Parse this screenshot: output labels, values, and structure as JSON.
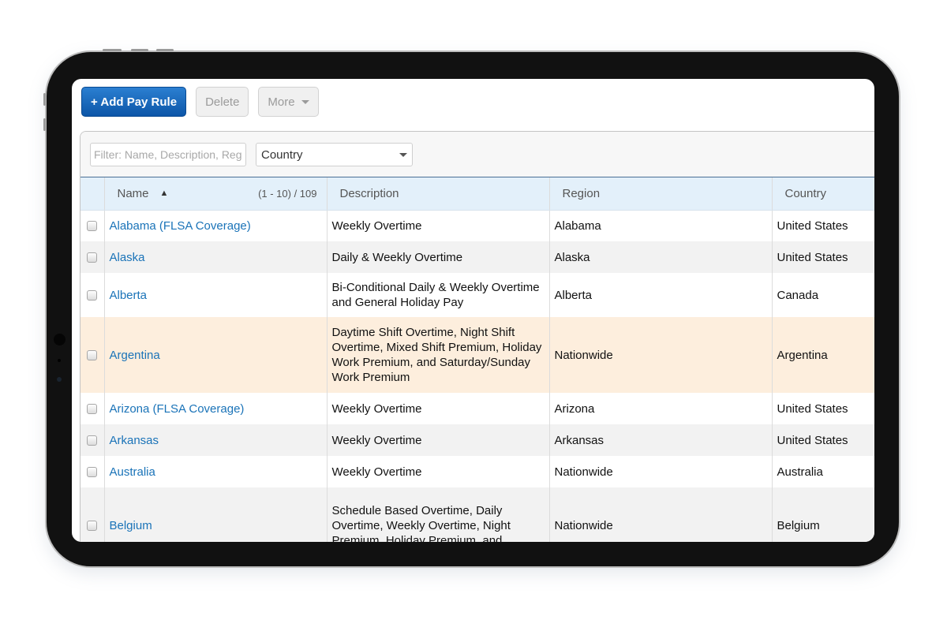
{
  "toolbar": {
    "add_label": "+ Add Pay Rule",
    "delete_label": "Delete",
    "more_label": "More"
  },
  "filters": {
    "search_placeholder": "Filter: Name, Description, Region",
    "search_value": "",
    "country_selected": "Country"
  },
  "table": {
    "columns": {
      "name": "Name",
      "sort_indicator": "▲",
      "record_count": "(1 - 10) / 109",
      "description": "Description",
      "region": "Region",
      "country": "Country"
    },
    "rows": [
      {
        "name": "Alabama (FLSA Coverage)",
        "description": "Weekly Overtime",
        "region": "Alabama",
        "country": "United States"
      },
      {
        "name": "Alaska",
        "description": "Daily & Weekly Overtime",
        "region": "Alaska",
        "country": "United States"
      },
      {
        "name": "Alberta",
        "description": "Bi-Conditional Daily & Weekly Overtime and General Holiday Pay",
        "region": "Alberta",
        "country": "Canada"
      },
      {
        "name": "Argentina",
        "description": "Daytime Shift Overtime, Night Shift Overtime, Mixed Shift Premium, Holiday Work Premium, and Saturday/Sunday Work Premium",
        "region": "Nationwide",
        "country": "Argentina"
      },
      {
        "name": "Arizona (FLSA Coverage)",
        "description": "Weekly Overtime",
        "region": "Arizona",
        "country": "United States"
      },
      {
        "name": "Arkansas",
        "description": "Weekly Overtime",
        "region": "Arkansas",
        "country": "United States"
      },
      {
        "name": "Australia",
        "description": "Weekly Overtime",
        "region": "Nationwide",
        "country": "Australia"
      },
      {
        "name": "Belgium",
        "description": "Schedule Based Overtime, Daily Overtime, Weekly Overtime, Night Premium, Holiday Premium, and",
        "region": "Nationwide",
        "country": "Belgium"
      }
    ]
  },
  "colors": {
    "primary_button": "#1565b8",
    "link": "#1a73b8",
    "header_bg": "#e3f0fa",
    "highlight_row": "#fdeedd",
    "alt_row": "#f2f2f2"
  }
}
